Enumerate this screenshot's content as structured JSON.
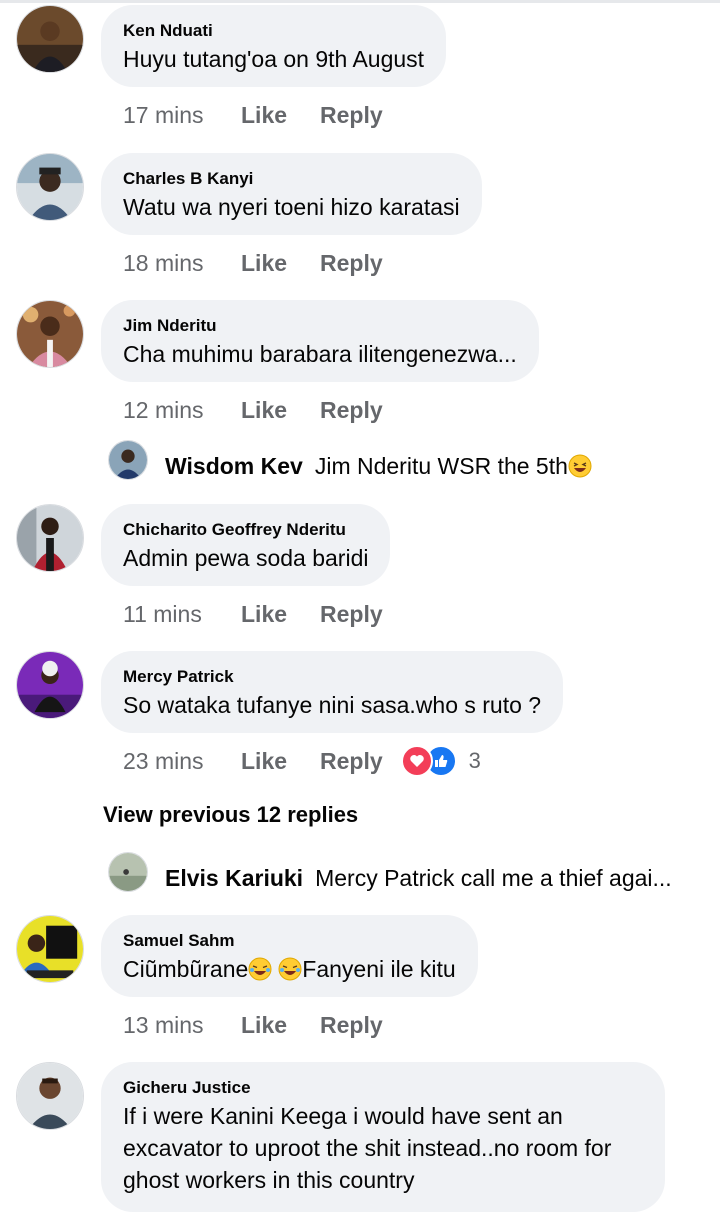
{
  "comments": [
    {
      "name": "Ken Nduati",
      "text": "Huyu tutang'oa on 9th August",
      "time": "17 mins",
      "like": "Like",
      "reply": "Reply"
    },
    {
      "name": "Charles B Kanyi",
      "text": "Watu wa nyeri toeni hizo karatasi",
      "time": "18 mins",
      "like": "Like",
      "reply": "Reply"
    },
    {
      "name": "Jim Nderitu",
      "text": "Cha muhimu barabara ilitengenezwa...",
      "time": "12 mins",
      "like": "Like",
      "reply": "Reply"
    },
    {
      "name": "Chicharito Geoffrey Nderitu",
      "text": "Admin pewa soda baridi",
      "time": "11 mins",
      "like": "Like",
      "reply": "Reply"
    },
    {
      "name": "Mercy Patrick",
      "text": "So wataka tufanye nini sasa.who s ruto ?",
      "time": "23 mins",
      "like": "Like",
      "reply": "Reply",
      "reaction_count": "3"
    },
    {
      "name": "Samuel Sahm",
      "text_a": "Ciũmbũrane",
      "text_b": "Fanyeni ile kitu",
      "time": "13 mins",
      "like": "Like",
      "reply": "Reply"
    },
    {
      "name": "Gicheru Justice",
      "text": "If i were Kanini Keega i would have sent an excavator to uproot the shit instead..no room for ghost workers in this country"
    }
  ],
  "replies": [
    {
      "name": "Wisdom Kev",
      "text": "Jim Nderitu WSR the 5th"
    },
    {
      "name": "Elvis Kariuki",
      "text": "Mercy Patrick call me a thief agai..."
    }
  ],
  "view_previous": "View previous 12 replies",
  "colors": {
    "bubble": "#f0f2f5",
    "meta": "#65676b",
    "love": "#f33e58",
    "like": "#1877f2"
  }
}
